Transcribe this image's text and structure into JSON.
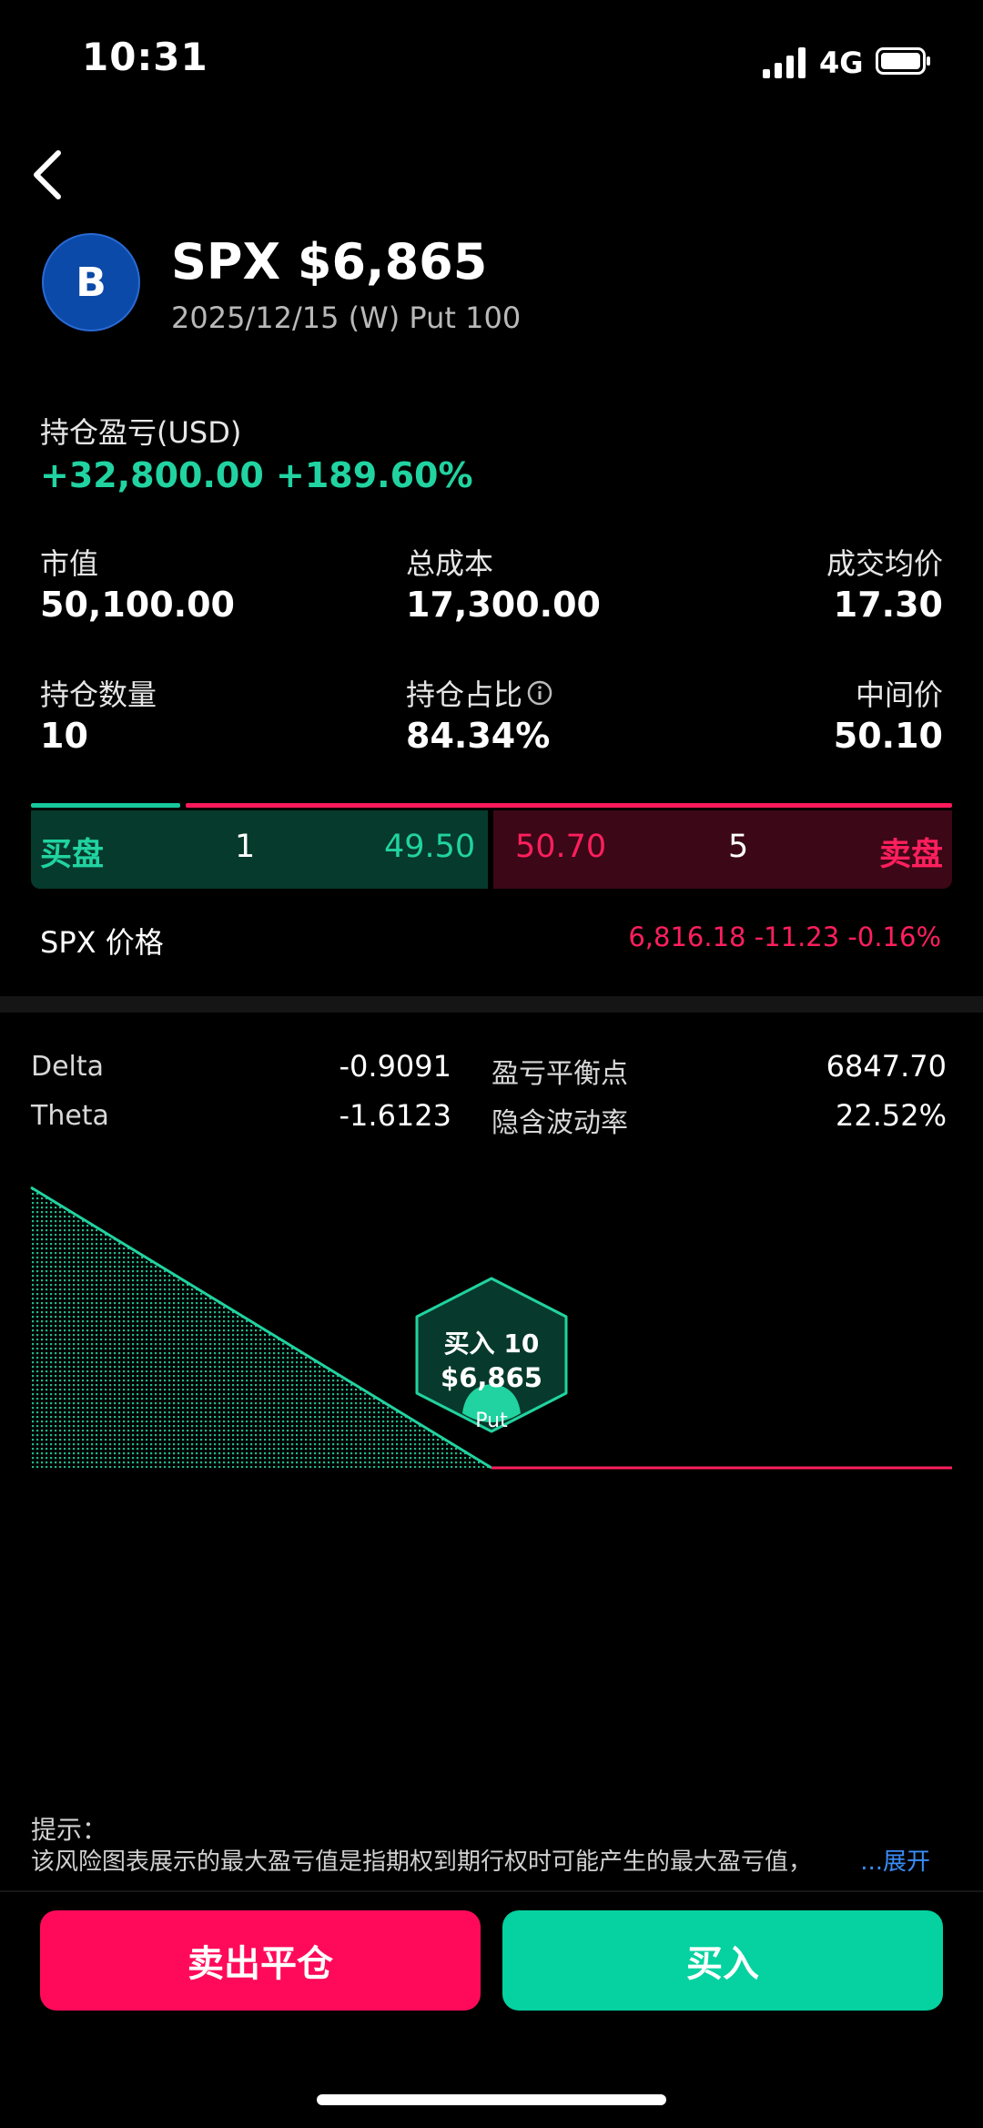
{
  "status_bar": {
    "time": "10:31",
    "network": "4G"
  },
  "header": {
    "avatar_letter": "B",
    "title": "SPX $6,865",
    "subtitle": "2025/12/15 (W) Put 100"
  },
  "pnl": {
    "label": "持仓盈亏(USD)",
    "value": "+32,800.00 +189.60%"
  },
  "stats": {
    "market_value_label": "市值",
    "market_value": "50,100.00",
    "total_cost_label": "总成本",
    "total_cost": "17,300.00",
    "avg_price_label": "成交均价",
    "avg_price": "17.30",
    "quantity_label": "持仓数量",
    "quantity": "10",
    "ratio_label": "持仓占比",
    "ratio": "84.34%",
    "mid_label": "中间价",
    "mid": "50.10"
  },
  "orderbook": {
    "bid_label": "买盘",
    "bid_size": "1",
    "bid_price": "49.50",
    "ask_price": "50.70",
    "ask_size": "5",
    "ask_label": "卖盘"
  },
  "underlying": {
    "label": "SPX 价格",
    "quote": "6,816.18 -11.23 -0.16%"
  },
  "greeks": {
    "delta_label": "Delta",
    "delta": "-0.9091",
    "theta_label": "Theta",
    "theta": "-1.6123",
    "breakeven_label": "盈亏平衡点",
    "breakeven": "6847.70",
    "iv_label": "隐含波动率",
    "iv": "22.52%"
  },
  "risk_chart": {
    "marker_line1": "买入 10",
    "marker_line2": "$6,865",
    "marker_tag": "Put"
  },
  "hint": {
    "title": "提示：",
    "text": "该风险图表展示的最大盈亏值是指期权到期行权时可能产生的最大盈亏值，",
    "expand": "...展开"
  },
  "actions": {
    "sell_close": "卖出平仓",
    "buy": "买入"
  },
  "colors": {
    "green": "#21d3a0",
    "pink": "#ff1f5e",
    "bg": "#000000"
  }
}
